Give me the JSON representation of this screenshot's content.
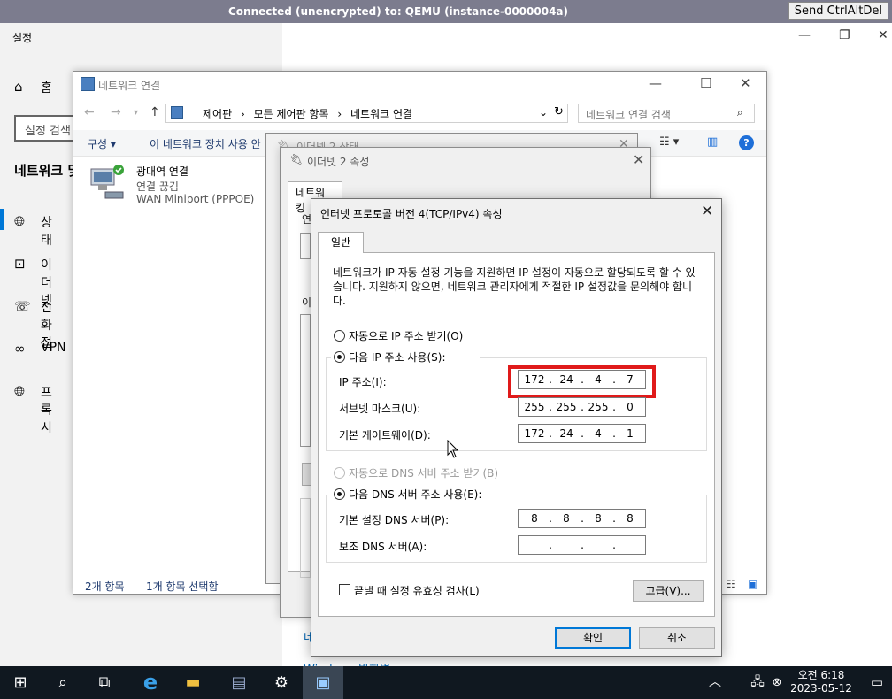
{
  "vnc": {
    "title": "Connected (unencrypted) to: QEMU (instance-0000004a)",
    "send_button": "Send CtrlAltDel"
  },
  "settings": {
    "app_title": "설정",
    "home_label": "홈",
    "search_placeholder": "설정 검색",
    "section_heading": "네트워크 및",
    "nav": [
      {
        "label": "상태",
        "icon": "globe-icon"
      },
      {
        "label": "이더넷",
        "icon": "ethernet-icon"
      },
      {
        "label": "전화 접",
        "icon": "dialup-icon"
      },
      {
        "label": "VPN",
        "icon": "vpn-icon"
      },
      {
        "label": "프록시",
        "icon": "globe-icon"
      }
    ],
    "bottom_link": "네",
    "bottom_link2": "Windows 방화벽"
  },
  "network_connections": {
    "title": "네트워크 연결",
    "breadcrumb": [
      "제어판",
      "모든 제어판 항목",
      "네트워크 연결"
    ],
    "search_placeholder": "네트워크 연결 검색",
    "toolbar": {
      "organize": "구성 ▾",
      "disable": "이 네트워크 장치 사용 안"
    },
    "adapter": {
      "name": "광대역 연결",
      "status": "연결 끊김",
      "device": "WAN Miniport (PPPOE)"
    },
    "status_items": "2개 항목",
    "status_selected": "1개 항목 선택함"
  },
  "ethernet_status": {
    "title": "이더넷 2 상태"
  },
  "ethernet_props": {
    "title": "이더넷 2 속성",
    "tab": "네트워킹",
    "connect_label": "연",
    "items_label": "이"
  },
  "tcpip": {
    "title": "인터넷 프로토콜 버전 4(TCP/IPv4) 속성",
    "tab": "일반",
    "description": "네트워크가 IP 자동 설정 기능을 지원하면 IP 설정이 자동으로 할당되도록 할 수 있습니다. 지원하지 않으면, 네트워크 관리자에게 적절한 IP 설정값을 문의해야 합니다.",
    "auto_ip_label": "자동으로 IP 주소 받기(O)",
    "manual_ip_label": "다음 IP 주소 사용(S):",
    "ip_mode": "manual",
    "ip_label": "IP 주소(I):",
    "ip": [
      "172",
      "24",
      "4",
      "7"
    ],
    "subnet_label": "서브넷 마스크(U):",
    "subnet": [
      "255",
      "255",
      "255",
      "0"
    ],
    "gateway_label": "기본 게이트웨이(D):",
    "gateway": [
      "172",
      "24",
      "4",
      "1"
    ],
    "auto_dns_label": "자동으로 DNS 서버 주소 받기(B)",
    "manual_dns_label": "다음 DNS 서버 주소 사용(E):",
    "dns_mode": "manual",
    "preferred_dns_label": "기본 설정 DNS 서버(P):",
    "preferred_dns": [
      "8",
      "8",
      "8",
      "8"
    ],
    "alternate_dns_label": "보조 DNS 서버(A):",
    "alternate_dns": [
      "",
      "",
      "",
      ""
    ],
    "validate_label": "끝낼 때 설정 유효성 검사(L)",
    "validate_checked": false,
    "advanced_button": "고급(V)...",
    "ok_button": "확인",
    "cancel_button": "취소"
  },
  "taskbar": {
    "time": "오전 6:18",
    "date": "2023-05-12"
  },
  "colors": {
    "highlight": "#e01a1a",
    "accent": "#0078d7",
    "taskbar": "#101820"
  }
}
